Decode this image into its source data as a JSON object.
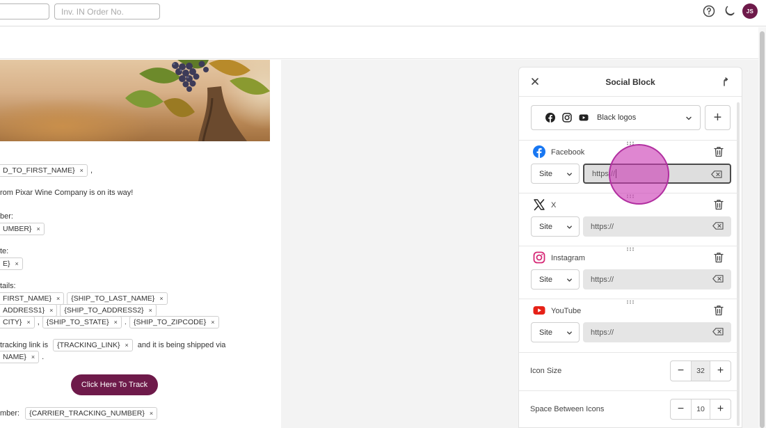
{
  "topbar": {
    "search_value": "",
    "order_placeholder": "Inv. IN Order No.",
    "avatar_initials": "JS",
    "help_icon": "help-circle-icon",
    "theme_icon": "moon-icon"
  },
  "email": {
    "greeting_tag": "D_TO_FIRST_NAME}",
    "greeting_suffix": ",",
    "line_on_way": "rom Pixar Wine Company is on its way!",
    "order_label": "ber:",
    "order_tag": "UMBER}",
    "date_label": "te:",
    "date_tag": "E}",
    "details_label": "tails:",
    "ship_first": "FIRST_NAME}",
    "ship_last": "{SHIP_TO_LAST_NAME}",
    "ship_addr1": "ADDRESS1}",
    "ship_addr2": "{SHIP_TO_ADDRESS2}",
    "ship_city": "CITY}",
    "comma": ",",
    "ship_state": "{SHIP_TO_STATE}",
    "dot": ".",
    "ship_zip": "{SHIP_TO_ZIPCODE}",
    "tracking_prefix": "tracking link is",
    "tracking_tag": "{TRACKING_LINK}",
    "tracking_suffix": "and it is being shipped via",
    "carrier_tag": "NAME}",
    "period": ".",
    "track_button": "Click Here To Track",
    "number_label": "mber:",
    "carrier_number_tag": "{CARRIER_TRACKING_NUMBER}",
    "tag_remove": "×"
  },
  "panel": {
    "title": "Social Block",
    "style_label": "Black logos",
    "add_label": "+",
    "networks": [
      {
        "name": "Facebook",
        "site": "Site",
        "url": "https://"
      },
      {
        "name": "X",
        "site": "Site",
        "url": "https://"
      },
      {
        "name": "Instagram",
        "site": "Site",
        "url": "https://"
      },
      {
        "name": "YouTube",
        "site": "Site",
        "url": "https://"
      }
    ],
    "icon_size_label": "Icon Size",
    "icon_size_value": "32",
    "spacing_label": "Space Between Icons",
    "spacing_value": "10",
    "minus": "−",
    "plus": "+"
  },
  "colors": {
    "brand": "#6e1a4a",
    "cursor": "#cc3cb4"
  }
}
